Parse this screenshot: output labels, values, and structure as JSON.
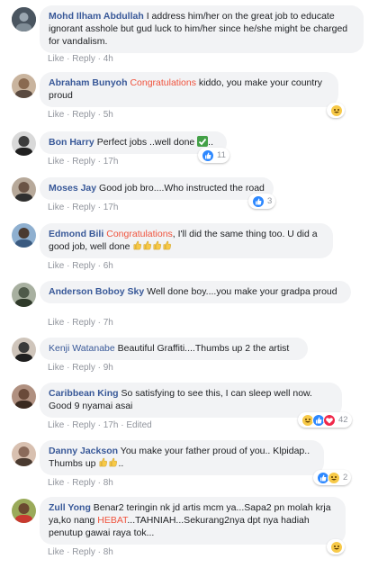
{
  "comments": [
    {
      "author": "Mohd Ilham Abdullah",
      "text_pre": "I address him/her on the great job to educate ignorant asshole but gud luck to him/her since he/she might be charged for vandalism.",
      "actions": {
        "like": "Like",
        "reply": "Reply",
        "time": "4h"
      },
      "avatar_color": "#4a5560"
    },
    {
      "author": "Abraham Bunyoh",
      "highlight": "Congratulations",
      "text_pre": "kiddo, you make your country proud",
      "actions": {
        "like": "Like",
        "reply": "Reply",
        "time": "5h"
      },
      "reactions": {
        "types": [
          "haha"
        ],
        "count": ""
      },
      "avatar_color": "#b08a6a"
    },
    {
      "author": "Bon Harry",
      "text_pre": "Perfect jobs ..well done",
      "text_post": "..",
      "actions": {
        "like": "Like",
        "reply": "Reply",
        "time": "17h"
      },
      "reactions": {
        "types": [
          "like"
        ],
        "count": "11"
      },
      "avatar_color": "#3c3c3c"
    },
    {
      "author": "Moses Jay",
      "text_pre": "Good job bro....Who instructed the road",
      "actions": {
        "like": "Like",
        "reply": "Reply",
        "time": "17h"
      },
      "reactions": {
        "types": [
          "like"
        ],
        "count": "3"
      },
      "avatar_color": "#7c6a5a"
    },
    {
      "author": "Edmond Bili",
      "highlight": "Congratulations",
      "text_pre": ", I'll did the same thing too. U did a good job, well done",
      "actions": {
        "like": "Like",
        "reply": "Reply",
        "time": "6h"
      },
      "avatar_color": "#5a7aa0"
    },
    {
      "author": "Anderson Boboy Sky",
      "text_pre": "Well done boy....you make your gradpa proud",
      "actions": {
        "like": "Like",
        "reply": "Reply",
        "time": "7h"
      },
      "avatar_color": "#4f5a4a"
    },
    {
      "author": "Kenji Watanabe",
      "text_pre": "Beautiful Graffiti....Thumbs up 2 the artist",
      "actions": {
        "like": "Like",
        "reply": "Reply",
        "time": "9h"
      },
      "avatar_color": "#3a3a3a"
    },
    {
      "author": "Caribbean King",
      "text_pre": "So satisfying to see this, I can sleep well now. Good 9 nyamai asai",
      "actions": {
        "like": "Like",
        "reply": "Reply",
        "time": "17h",
        "edited": "Edited"
      },
      "reactions": {
        "types": [
          "haha",
          "like",
          "love"
        ],
        "count": "42"
      },
      "avatar_color": "#6a4a3a"
    },
    {
      "author": "Danny Jackson",
      "text_pre": "You make your father proud of you.. Klpidap.. Thumbs up",
      "text_post": "..",
      "actions": {
        "like": "Like",
        "reply": "Reply",
        "time": "8h"
      },
      "reactions": {
        "types": [
          "like",
          "haha"
        ],
        "count": "2"
      },
      "avatar_color": "#8a6a5a"
    },
    {
      "author": "Zull Yong",
      "text_pre": "Benar2 teringin nk jd artis mcm ya...Sapa2 pn molah krja ya,ko nang ",
      "highlight": "HEBAT",
      "text_post": "...TAHNIAH...Sekurang2nya dpt nya hadiah penutup gawai raya tok...",
      "actions": {
        "like": "Like",
        "reply": "Reply",
        "time": "8h"
      },
      "reactions": {
        "types": [
          "haha"
        ],
        "count": ""
      },
      "avatar_color": "#7a8a3a"
    }
  ],
  "separator": "·"
}
